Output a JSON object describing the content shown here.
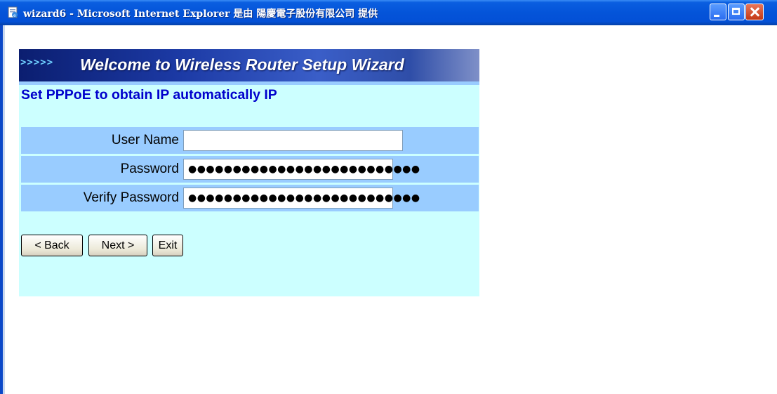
{
  "window": {
    "title": "wizard6 - Microsoft Internet Explorer 是由 陽慶電子股份有限公司 提供"
  },
  "banner": {
    "arrows": ">>>>>",
    "title": "Welcome to Wireless Router Setup Wizard"
  },
  "page": {
    "heading": "Set PPPoE to obtain IP automatically IP"
  },
  "form": {
    "rows": [
      {
        "label": "User Name",
        "value": ""
      },
      {
        "label": "Password",
        "value": "●●●●●●●●●●●●●●●●●●●●●●●●●●"
      },
      {
        "label": "Verify Password",
        "value": "●●●●●●●●●●●●●●●●●●●●●●●●●●"
      }
    ]
  },
  "buttons": {
    "back": "< Back",
    "next": "Next >",
    "exit": "Exit"
  },
  "icons": {
    "app": "ie-page-icon",
    "minimize": "minimize-icon",
    "maximize": "maximize-icon",
    "close": "close-icon"
  },
  "colors": {
    "titlebar": "#0454d9",
    "panel": "#ccffff",
    "row": "#99ccff",
    "heading": "#0000cc"
  }
}
